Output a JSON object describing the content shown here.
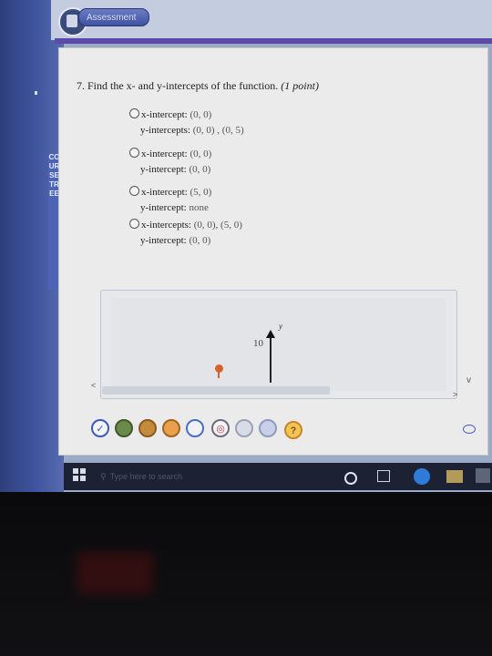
{
  "header": {
    "tab_label": "Assessment"
  },
  "sidebar": {
    "vertical_tab_text": "COURSE TREE"
  },
  "question": {
    "number": "7.",
    "text": "Find the x- and y-intercepts of the function.",
    "points": "(1 point)"
  },
  "options": [
    {
      "line1_label": "x-intercept:",
      "line1_value": "(0, 0)",
      "line2_label": "y-intercepts:",
      "line2_value": "(0, 0) , (0, 5)"
    },
    {
      "line1_label": "x-intercept:",
      "line1_value": "(0, 0)",
      "line2_label": "y-intercept:",
      "line2_value": "(0, 0)"
    },
    {
      "line1_label": "x-intercept:",
      "line1_value": "(5, 0)",
      "line2_label": "y-intercept:",
      "line2_value": "none"
    },
    {
      "line1_label": "x-intercepts:",
      "line1_value": "(0, 0), (5, 0)",
      "line2_label": "y-intercept:",
      "line2_value": "(0, 0)"
    }
  ],
  "graph": {
    "y_axis_label": "y",
    "tick_label": "10"
  },
  "scroll": {
    "left": "<",
    "right": ">",
    "down": "v"
  },
  "toolbar": {
    "help": "?"
  },
  "taskbar": {
    "search_placeholder": "Type here to search"
  },
  "colors": {
    "accent_purple": "#5b4aa8",
    "point_orange": "#d4622a",
    "rail_blue": "#3a4e96"
  }
}
